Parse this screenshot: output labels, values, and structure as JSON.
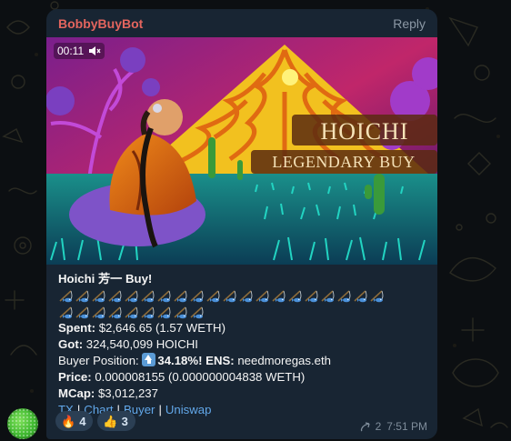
{
  "message": {
    "sender": "BobbyBuyBot",
    "reply_label": "Reply",
    "video": {
      "duration": "00:11",
      "overlay_title": "HOICHI",
      "overlay_subtitle": "LEGENDARY BUY"
    },
    "header_line": {
      "name": "Hoichi 芳一",
      "suffix": " Buy!"
    },
    "fish_rows": [
      20,
      9
    ],
    "spent": {
      "label": "Spent:",
      "value": " $2,646.65 (1.57 WETH)"
    },
    "got": {
      "label": "Got:",
      "value": " 324,540,099 HOICHI"
    },
    "buyer_position": {
      "label": "Buyer Position: ",
      "pct": "34.18%!",
      "ens_label": " ENS:",
      "ens_value": " needmoregas.eth"
    },
    "price": {
      "label": "Price:",
      "value": " 0.000008155 (0.000000004838 WETH)"
    },
    "mcap": {
      "label": "MCap:",
      "value": " $3,012,237"
    },
    "links": [
      "TX",
      "Chart",
      "Buyer",
      "Uniswap"
    ],
    "link_separator": "|",
    "reactions": [
      {
        "emoji": "🔥",
        "count": "4"
      },
      {
        "emoji": "👍",
        "count": "3"
      }
    ],
    "forward_count": "2",
    "time": "7:51 PM"
  },
  "colors": {
    "bubble": "#182533",
    "sender": "#e4655e",
    "link": "#62a8ea",
    "background": "#0c0f12"
  },
  "icons": {
    "mute": "speaker-muted-icon",
    "fish": "fishing-pole-icon",
    "up": "up-arrow-icon",
    "forward": "forward-arrow-icon"
  }
}
